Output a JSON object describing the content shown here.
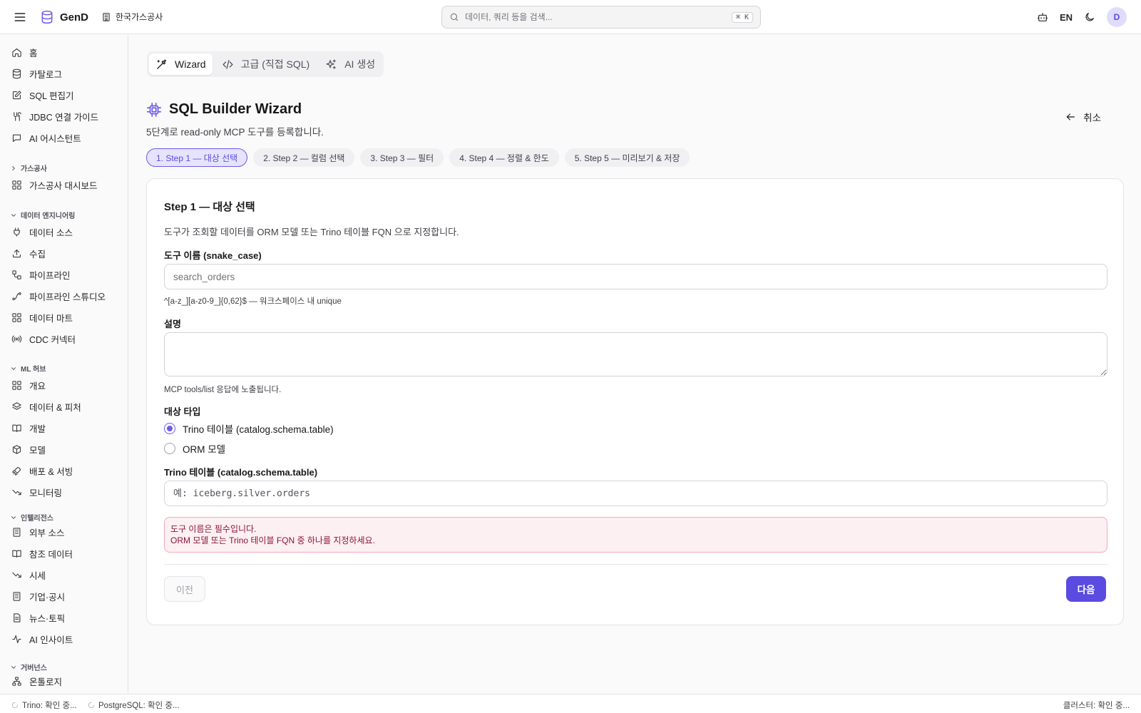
{
  "app": {
    "name": "GenD",
    "org": "한국가스공사"
  },
  "search": {
    "placeholder": "데이터, 쿼리 등을 검색...",
    "shortcut": "⌘ K"
  },
  "topbar": {
    "lang": "EN",
    "avatar": "D"
  },
  "sidebar": {
    "items_top": [
      {
        "label": "홈",
        "icon": "home-icon"
      },
      {
        "label": "카탈로그",
        "icon": "database-icon"
      },
      {
        "label": "SQL 편집기",
        "icon": "edit-icon"
      },
      {
        "label": "JDBC 연결 가이드",
        "icon": "link-icon"
      },
      {
        "label": "AI 어시스턴트",
        "icon": "chat-icon"
      }
    ],
    "sections": [
      {
        "title": "가스공사",
        "collapsed": true,
        "items": [
          {
            "label": "가스공사 대시보드",
            "icon": "grid-icon"
          }
        ]
      },
      {
        "title": "데이터 엔지니어링",
        "collapsed": false,
        "items": [
          {
            "label": "데이터 소스",
            "icon": "plug-icon"
          },
          {
            "label": "수집",
            "icon": "upload-icon"
          },
          {
            "label": "파이프라인",
            "icon": "workflow-icon"
          },
          {
            "label": "파이프라인 스튜디오",
            "icon": "spline-icon"
          },
          {
            "label": "데이터 마트",
            "icon": "grid-icon"
          },
          {
            "label": "CDC 커넥터",
            "icon": "radio-waves-icon"
          }
        ]
      },
      {
        "title": "ML 허브",
        "collapsed": false,
        "items": [
          {
            "label": "개요",
            "icon": "grid-icon"
          },
          {
            "label": "데이터 & 피처",
            "icon": "layers-icon"
          },
          {
            "label": "개발",
            "icon": "book-icon"
          },
          {
            "label": "모델",
            "icon": "box-icon"
          },
          {
            "label": "배포 & 서빙",
            "icon": "rocket-icon"
          },
          {
            "label": "모니터링",
            "icon": "trend-down-icon"
          }
        ]
      },
      {
        "title": "인텔리전스",
        "collapsed": false,
        "items": [
          {
            "label": "외부 소스",
            "icon": "building-icon"
          },
          {
            "label": "참조 데이터",
            "icon": "book-icon"
          },
          {
            "label": "시세",
            "icon": "trend-down-icon"
          },
          {
            "label": "기업·공시",
            "icon": "building-icon"
          },
          {
            "label": "뉴스·토픽",
            "icon": "file-icon"
          },
          {
            "label": "AI 인사이트",
            "icon": "activity-icon"
          }
        ]
      },
      {
        "title": "거버넌스",
        "collapsed": false,
        "items": [
          {
            "label": "온톨로지",
            "icon": "network-icon"
          }
        ]
      }
    ]
  },
  "modes": [
    {
      "label": "Wizard",
      "icon": "wand-icon",
      "active": true
    },
    {
      "label": "고급 (직접 SQL)",
      "icon": "code-icon",
      "active": false
    },
    {
      "label": "AI 생성",
      "icon": "sparkles-icon",
      "active": false
    }
  ],
  "page": {
    "title": "SQL Builder Wizard",
    "subtitle": "5단계로 read-only MCP 도구를 등록합니다.",
    "cancel": "취소"
  },
  "steps": [
    {
      "label": "1. Step 1 — 대상 선택",
      "active": true
    },
    {
      "label": "2. Step 2 — 컬럼 선택",
      "active": false
    },
    {
      "label": "3. Step 3 — 필터",
      "active": false
    },
    {
      "label": "4. Step 4 — 정렬 & 한도",
      "active": false
    },
    {
      "label": "5. Step 5 — 미리보기 & 저장",
      "active": false
    }
  ],
  "form": {
    "title": "Step 1 — 대상 선택",
    "description": "도구가 조회할 데이터를 ORM 모델 또는 Trino 테이블 FQN 으로 지정합니다.",
    "tool_name_label": "도구 이름 (snake_case)",
    "tool_name_placeholder": "search_orders",
    "tool_name_hint": "^[a-z_][a-z0-9_]{0,62}$ — 워크스페이스 내 unique",
    "desc_label": "설명",
    "desc_value": "",
    "desc_hint": "MCP tools/list 응답에 노출됩니다.",
    "target_type_label": "대상 타입",
    "target_options": [
      {
        "label": "Trino 테이블 (catalog.schema.table)",
        "selected": true
      },
      {
        "label": "ORM 모델",
        "selected": false
      }
    ],
    "trino_label": "Trino 테이블 (catalog.schema.table)",
    "trino_placeholder": "예: iceberg.silver.orders",
    "errors": [
      "도구 이름은 필수입니다.",
      "ORM 모델 또는 Trino 테이블 FQN 중 하나를 지정하세요."
    ],
    "prev": "이전",
    "next": "다음"
  },
  "status": {
    "trino": "Trino: 확인 중...",
    "postgres": "PostgreSQL: 확인 중...",
    "cluster": "클러스터: 확인 중..."
  },
  "colors": {
    "accent": "#5b4be0",
    "accent_soft": "#e6e3fd",
    "error_bg": "#fdf0f3",
    "error_text": "#8a1538"
  }
}
